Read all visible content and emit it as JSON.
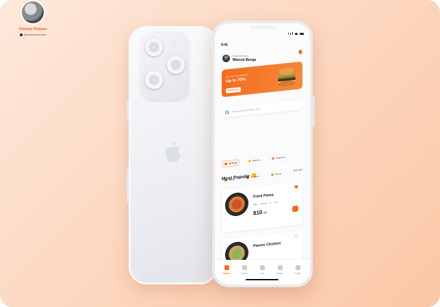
{
  "author": {
    "name": "Odebiyi Ridwan",
    "handle": "@iamridwancodes"
  },
  "phone": {
    "status_time": "9:41",
    "greeting": "Good Afternoon",
    "user_name": "Marcia Berge",
    "promo": {
      "small_text": "Get your best discount",
      "headline": "Up to 70%",
      "button_label": "Claim now"
    },
    "search_placeholder": "What would you like to eat?",
    "categories": [
      {
        "label": "All food",
        "color": "#f26b1d",
        "active": true
      },
      {
        "label": "Bakers",
        "color": "#f3b23e",
        "active": false
      },
      {
        "label": "Seafood",
        "color": "#e98b5a",
        "active": false
      },
      {
        "label": "Burger",
        "color": "#c4792e",
        "active": false
      },
      {
        "label": "Chicken",
        "color": "#d3564a",
        "active": false
      },
      {
        "label": "Pizza",
        "color": "#e6a23a",
        "active": false
      }
    ],
    "section_title": "Most Popular 😋",
    "view_all": "View all ›",
    "items": [
      {
        "name": "Fried Pasta",
        "distance": "2km",
        "time": "23 min",
        "rating": "4.5",
        "price_main": "$10",
        "price_cents": ".49"
      },
      {
        "name": "Pieces Chicken",
        "distance": "",
        "time": "",
        "rating": "",
        "price_main": "",
        "price_cents": ""
      }
    ],
    "tabs": [
      {
        "label": "Home",
        "icon": "home-icon",
        "active": true
      },
      {
        "label": "Saved",
        "icon": "heart-icon",
        "active": false
      },
      {
        "label": "Cart",
        "icon": "cart-icon",
        "active": false
      },
      {
        "label": "Orders",
        "icon": "orders-icon",
        "active": false
      },
      {
        "label": "Profile",
        "icon": "profile-icon",
        "active": false
      }
    ]
  },
  "colors": {
    "accent": "#f26b1d",
    "background_start": "#fde9dc",
    "background_end": "#fbc7a6"
  }
}
